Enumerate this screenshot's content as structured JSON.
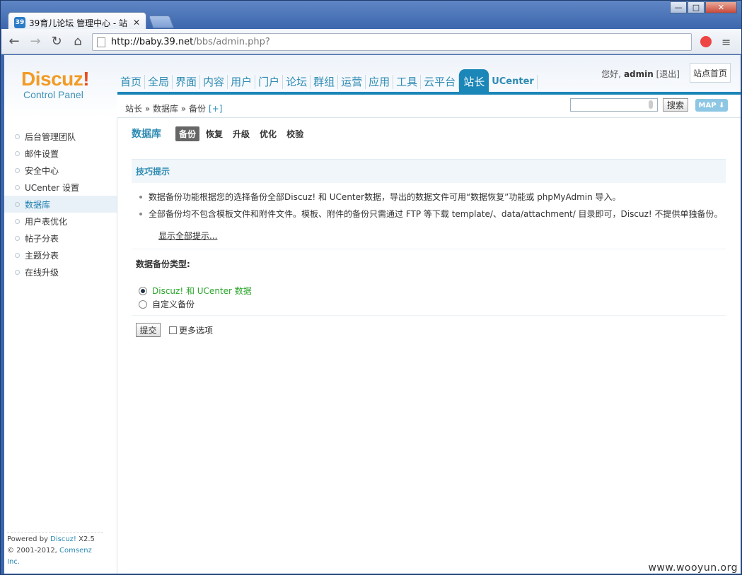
{
  "browser": {
    "tab_title": "39育儿论坛 管理中心 - 站",
    "tab_favicon_text": "39",
    "url_host": "http://baby.39.net",
    "url_path": "/bbs/admin.php?",
    "window_buttons": {
      "minimize": "—",
      "maximize": "□",
      "close": "✕"
    }
  },
  "logo": {
    "word": "Discuz",
    "bang": "!",
    "sub": "Control Panel"
  },
  "topnav": [
    {
      "label": "首页"
    },
    {
      "label": "全局"
    },
    {
      "label": "界面"
    },
    {
      "label": "内容"
    },
    {
      "label": "用户"
    },
    {
      "label": "门户"
    },
    {
      "label": "论坛"
    },
    {
      "label": "群组"
    },
    {
      "label": "运营"
    },
    {
      "label": "应用"
    },
    {
      "label": "工具"
    },
    {
      "label": "云平台"
    },
    {
      "label": "站长"
    },
    {
      "label": "UCenter"
    }
  ],
  "topnav_active": "站长",
  "user": {
    "greeting": "您好,",
    "name": "admin",
    "logout": "[退出]",
    "site_home": "站点首页"
  },
  "breadcrumb": {
    "text": "站长 » 数据库 » 备份",
    "plus": "[+]"
  },
  "search": {
    "button": "搜索",
    "map": "MAP ⬇"
  },
  "sidebar": {
    "items": [
      {
        "label": "后台管理团队"
      },
      {
        "label": "邮件设置"
      },
      {
        "label": "安全中心"
      },
      {
        "label": "UCenter 设置"
      },
      {
        "label": "数据库"
      },
      {
        "label": "用户表优化"
      },
      {
        "label": "帖子分表"
      },
      {
        "label": "主题分表"
      },
      {
        "label": "在线升级"
      }
    ],
    "active": "数据库",
    "footer": {
      "powered": "Powered by ",
      "product": "Discuz!",
      "version": " X2.5",
      "copy": "© 2001-2012, ",
      "company": "Comsenz Inc."
    }
  },
  "main": {
    "heading": "数据库",
    "tabs": [
      {
        "label": "备份"
      },
      {
        "label": "恢复"
      },
      {
        "label": "升级"
      },
      {
        "label": "优化"
      },
      {
        "label": "校验"
      }
    ],
    "active_tab": "备份",
    "tip_title": "技巧提示",
    "tips": [
      "数据备份功能根据您的选择备份全部Discuz! 和 UCenter数据，导出的数据文件可用“数据恢复”功能或 phpMyAdmin 导入。",
      "全部备份均不包含模板文件和附件文件。模板、附件的备份只需通过 FTP 等下载 template/、data/attachment/ 目录即可，Discuz! 不提供单独备份。"
    ],
    "show_all": "显示全部提示...",
    "type_label": "数据备份类型:",
    "options": [
      {
        "label": "Discuz! 和 UCenter 数据",
        "checked": true
      },
      {
        "label": "自定义备份",
        "checked": false
      }
    ],
    "submit": "提交",
    "more_options": "更多选项"
  },
  "watermark": "www.wooyun.org"
}
